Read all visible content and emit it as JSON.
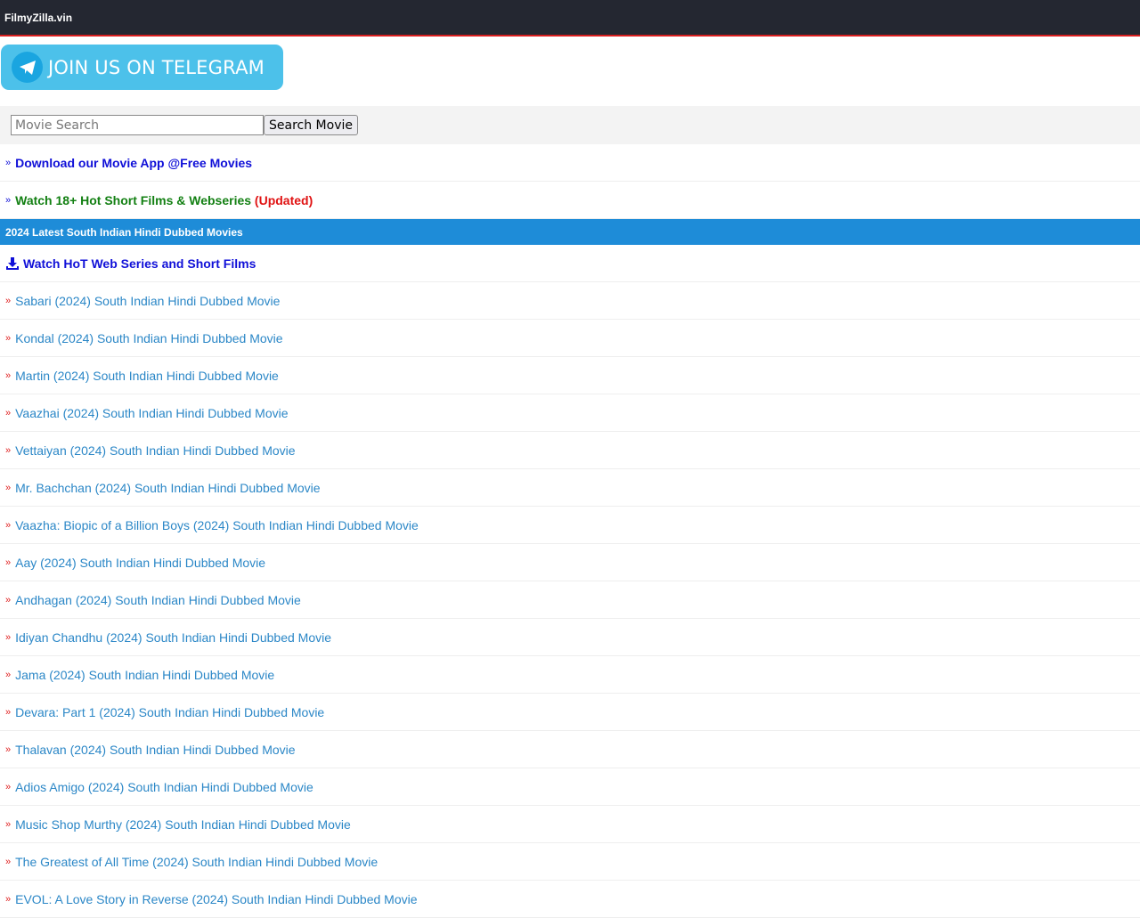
{
  "header": {
    "site_name": "FilmyZilla.vin"
  },
  "telegram": {
    "label": "JOIN US ON TELEGRAM"
  },
  "search": {
    "placeholder": "Movie Search",
    "button": "Search Movie"
  },
  "promo": {
    "app_link": "Download our Movie App @Free Movies",
    "hot_link": "Watch 18+ Hot Short Films & Webseries",
    "hot_badge": "(Updated)"
  },
  "section": {
    "title": "2024 Latest South Indian Hindi Dubbed Movies",
    "hot_series": "Watch HoT Web Series and Short Films"
  },
  "raquo": "»",
  "movies": [
    "Sabari (2024) South Indian Hindi Dubbed Movie",
    "Kondal (2024) South Indian Hindi Dubbed Movie",
    "Martin (2024) South Indian Hindi Dubbed Movie",
    "Vaazhai (2024) South Indian Hindi Dubbed Movie",
    "Vettaiyan (2024) South Indian Hindi Dubbed Movie",
    "Mr. Bachchan (2024) South Indian Hindi Dubbed Movie",
    "Vaazha: Biopic of a Billion Boys (2024) South Indian Hindi Dubbed Movie",
    "Aay (2024) South Indian Hindi Dubbed Movie",
    "Andhagan (2024) South Indian Hindi Dubbed Movie",
    "Idiyan Chandhu (2024) South Indian Hindi Dubbed Movie",
    "Jama (2024) South Indian Hindi Dubbed Movie",
    "Devara: Part 1 (2024) South Indian Hindi Dubbed Movie",
    "Thalavan (2024) South Indian Hindi Dubbed Movie",
    "Adios Amigo (2024) South Indian Hindi Dubbed Movie",
    "Music Shop Murthy (2024) South Indian Hindi Dubbed Movie",
    "The Greatest of All Time (2024) South Indian Hindi Dubbed Movie",
    "EVOL: A Love Story in Reverse (2024) South Indian Hindi Dubbed Movie"
  ]
}
